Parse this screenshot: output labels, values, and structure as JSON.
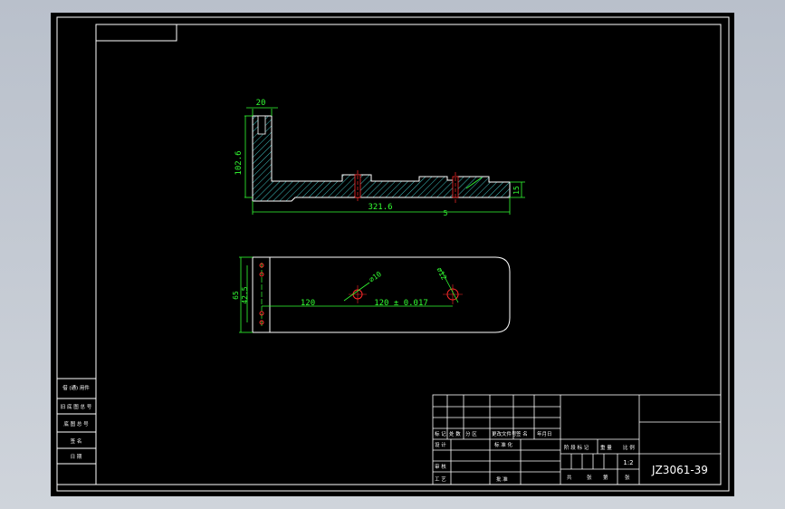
{
  "drawing": {
    "number": "JZ3061-39",
    "scale": "1:2",
    "colors": {
      "background": "#000000",
      "frame": "#ffffff",
      "dimension": "#33ff33",
      "hatch": "#3fbfbf",
      "center": "#ff2a2a"
    }
  },
  "top_view": {
    "dim_top_width": "20",
    "dim_height": "102.6",
    "dim_length": "321.6",
    "dim_right": "15",
    "dim_small": "5"
  },
  "plan_view": {
    "dim_height_outer": "65",
    "dim_height_inner": "42.5",
    "dim_left_span": "120",
    "dim_right_span": "120 ± 0.017",
    "hole_left": "⌀10",
    "hole_right": "⌀12"
  },
  "left_stamps": [
    "借 (通) 用件",
    "旧 底 图 总 号",
    "底 图 总 号",
    "签 名",
    "日 期"
  ],
  "title_block": {
    "row_labels": [
      "标 记",
      "处 数",
      "分 区",
      "更改文件号",
      "签 名",
      "年月日"
    ],
    "design": "设 计",
    "standard": "标 准 化",
    "check": "审 核",
    "process": "工 艺",
    "approve": "批 准",
    "stage": "阶 段 标 记",
    "weight": "重 量",
    "scale_label": "比 例",
    "sheet_a": "共",
    "sheet_b": "张",
    "sheet_c": "第",
    "sheet_d": "张"
  }
}
